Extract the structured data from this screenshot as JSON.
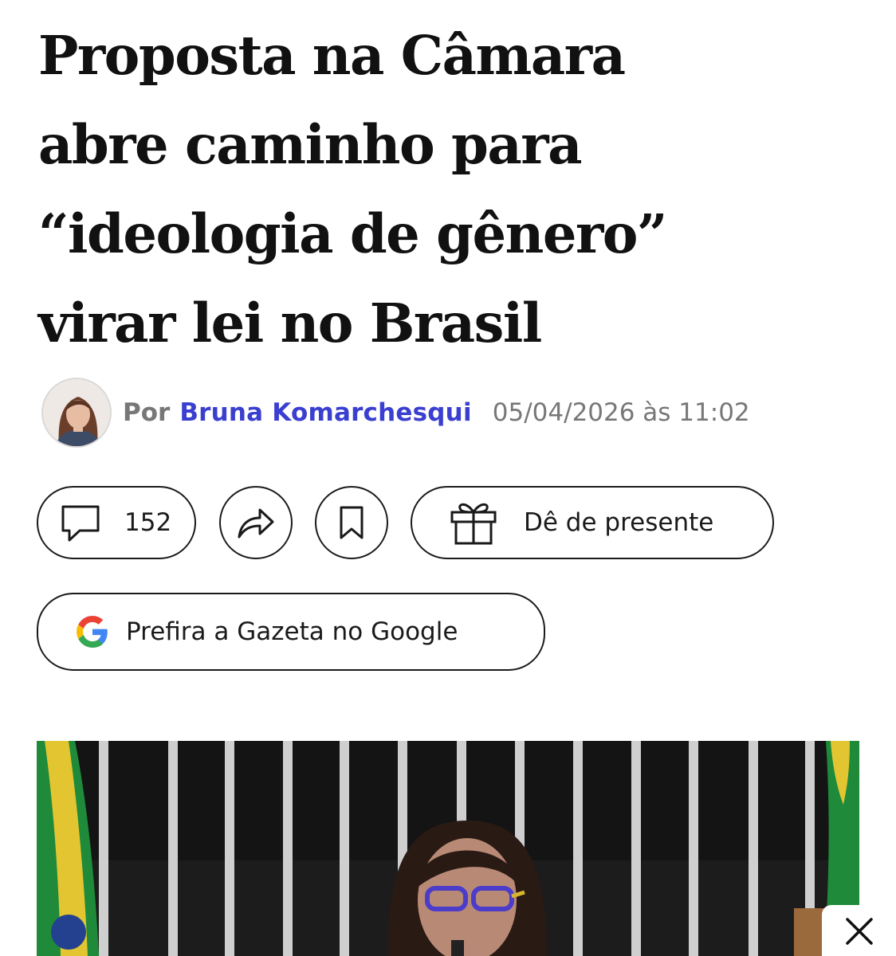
{
  "article": {
    "headline_lines": [
      "Proposta na Câmara",
      "abre caminho para",
      "“ideologia de gênero”",
      "virar lei no Brasil"
    ],
    "byline": {
      "prefix": "Por",
      "author": "Bruna Komarchesqui",
      "date": "05/04/2026 às 11:02"
    }
  },
  "actions": {
    "comments_count": "152",
    "gift_label": "Dê de presente",
    "google_label": "Prefira a Gazeta no Google"
  },
  "icons": {
    "comments": "speech-bubble-icon",
    "share": "share-arrow-icon",
    "save": "bookmark-icon",
    "gift": "gift-icon",
    "google": "google-g-icon",
    "close": "close-icon"
  },
  "colors": {
    "author_link": "#3a3fd0",
    "meta_gray": "#777777",
    "button_border": "#1a1a1a"
  }
}
